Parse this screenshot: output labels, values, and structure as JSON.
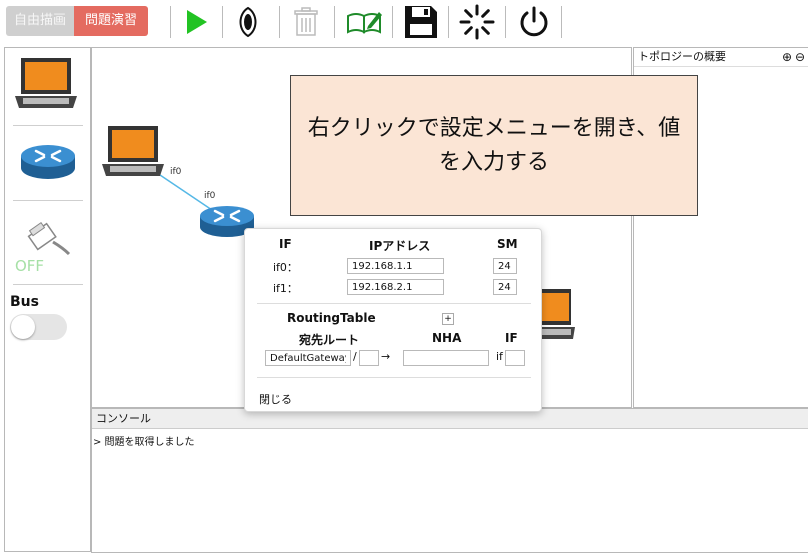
{
  "toolbar": {
    "mode_free": "自由描画",
    "mode_practice": "問題演習",
    "icons": [
      "play-icon",
      "eye-icon",
      "trash-icon",
      "book-edit-icon",
      "save-icon",
      "loading-icon",
      "power-icon"
    ]
  },
  "palette": {
    "switch_state": "OFF",
    "bus_label": "Bus"
  },
  "canvas": {
    "pc_if_label": "if0",
    "router_if_label": "if0"
  },
  "callout": {
    "text": "右クリックで設定メニューを開き、値を入力する"
  },
  "popup": {
    "header_if": "IF",
    "header_ip": "IPアドレス",
    "header_sm": "SM",
    "interfaces": [
      {
        "name": "if0：",
        "ip": "192.168.1.1",
        "sm": "24"
      },
      {
        "name": "if1：",
        "ip": "192.168.2.1",
        "sm": "24"
      }
    ],
    "routing_title": "RoutingTable",
    "routing_add": "+",
    "route_dest_header": "宛先ルート",
    "route_nha_header": "NHA",
    "route_if_header": "IF",
    "route_dest_value": "DefaultGateway",
    "route_slash": "/",
    "route_arrow": "→",
    "route_if_prefix": "if",
    "close_label": "閉じる"
  },
  "topology": {
    "title": "トポロジーの概要",
    "zoom_in": "⊕",
    "zoom_out": "⊖"
  },
  "console": {
    "title": "コンソール",
    "lines": [
      "> 問題を取得しました"
    ]
  },
  "colors": {
    "accent_practice": "#e46b60",
    "play_green": "#22c323",
    "callout_bg": "#fbe5d5",
    "router_blue": "#2f7fc1",
    "laptop_orange": "#f08c1e"
  }
}
